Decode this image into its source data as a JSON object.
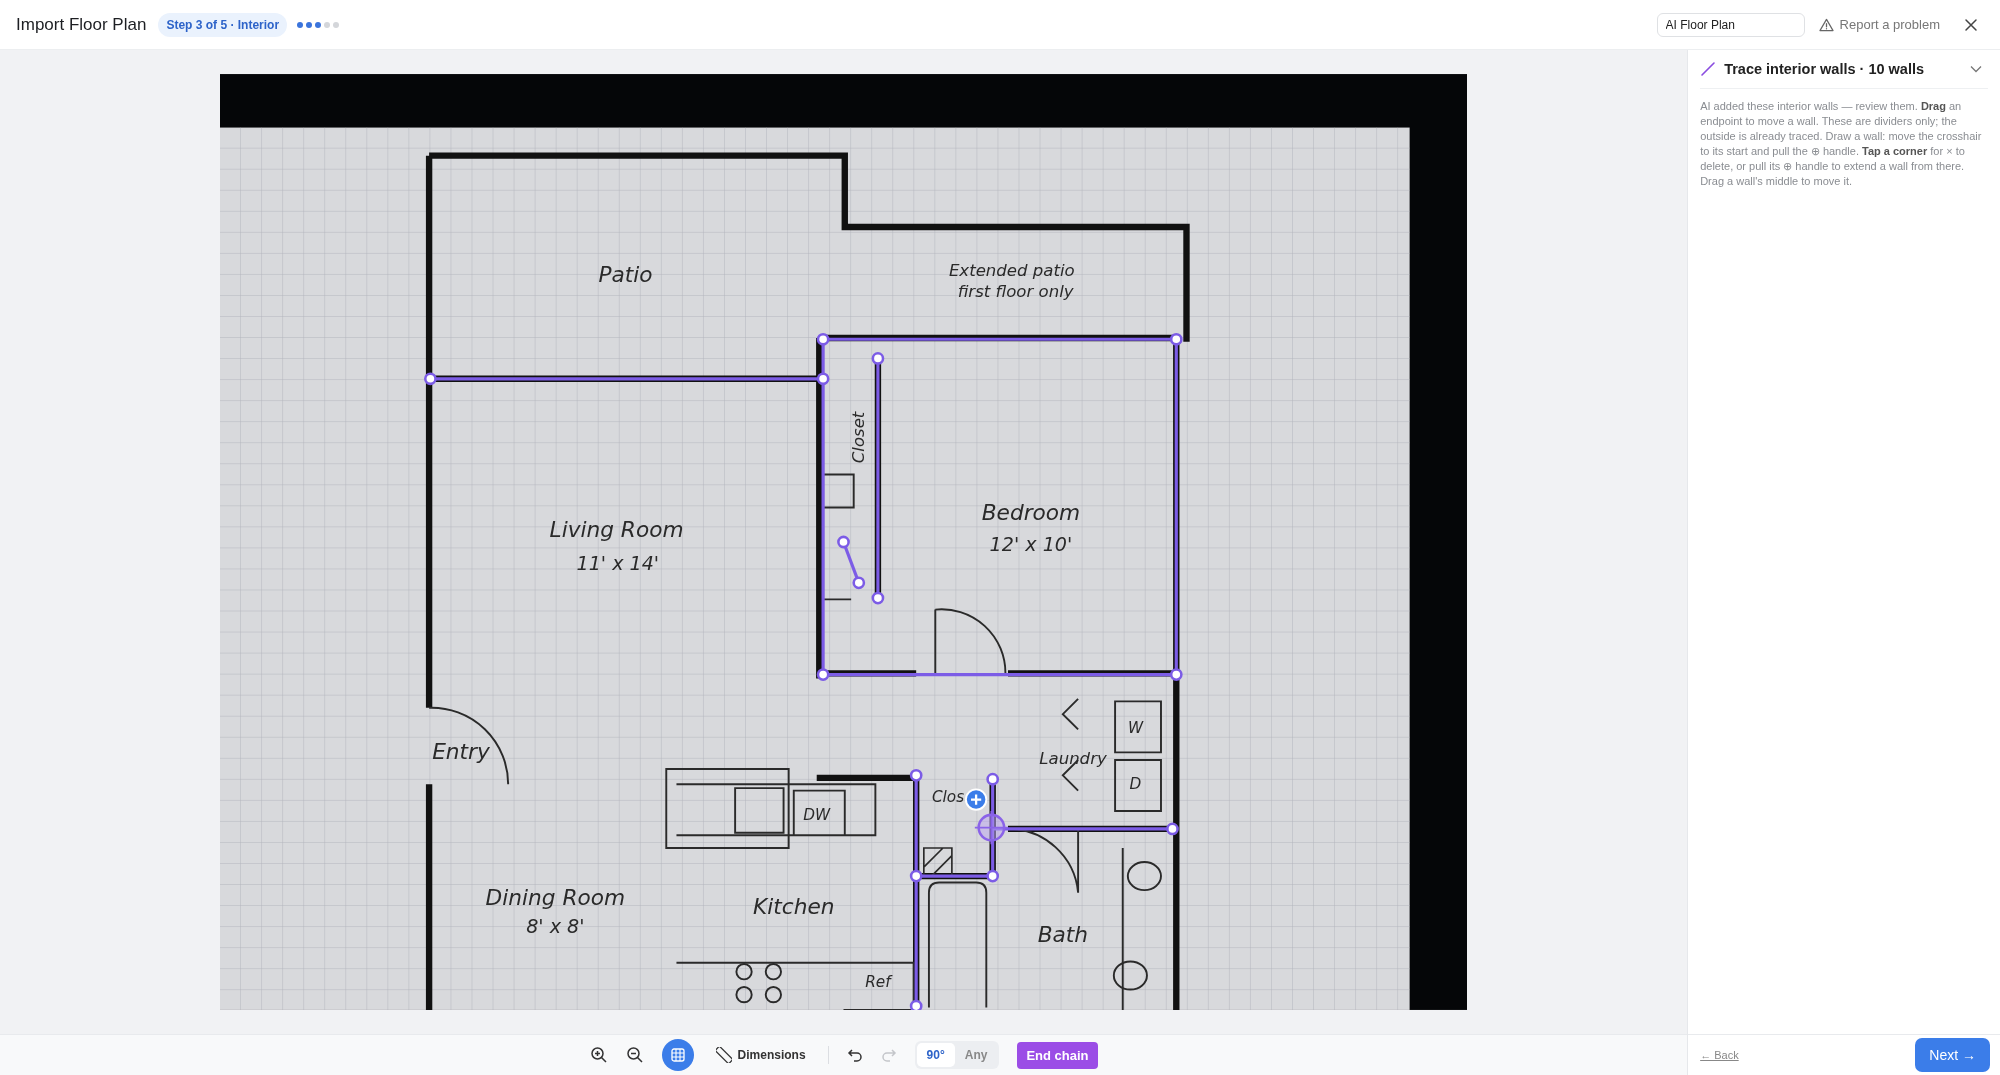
{
  "header": {
    "title": "Import Floor Plan",
    "step_badge": "Step 3 of 5 · Interior",
    "progress_dots": [
      {
        "filled": true
      },
      {
        "filled": true
      },
      {
        "filled": true
      },
      {
        "filled": false
      },
      {
        "filled": false
      }
    ],
    "plan_name": {
      "value": "AI Floor Plan"
    },
    "report_link": "Report a problem"
  },
  "plan": {
    "labels": [
      {
        "text": "Patio",
        "kind": "room"
      },
      {
        "text": "Extended patio",
        "kind": "note"
      },
      {
        "text": "first floor only",
        "kind": "note"
      },
      {
        "text": "Living Room",
        "kind": "room"
      },
      {
        "text": "11' x 14'",
        "kind": "size"
      },
      {
        "text": "Bedroom",
        "kind": "room"
      },
      {
        "text": "12' x 10'",
        "kind": "size"
      },
      {
        "text": "Closet",
        "kind": "note"
      },
      {
        "text": "Entry",
        "kind": "room"
      },
      {
        "text": "Laundry",
        "kind": "note"
      },
      {
        "text": "W",
        "kind": "fixture"
      },
      {
        "text": "D",
        "kind": "fixture"
      },
      {
        "text": "Clos",
        "kind": "fixture"
      },
      {
        "text": "DW",
        "kind": "fixture"
      },
      {
        "text": "Dining Room",
        "kind": "room"
      },
      {
        "text": "8' x 8'",
        "kind": "size"
      },
      {
        "text": "Kitchen",
        "kind": "room"
      },
      {
        "text": "Bath",
        "kind": "room"
      },
      {
        "text": "Ref",
        "kind": "fixture"
      }
    ]
  },
  "toolbar": {
    "grid_on": true,
    "dimensions": "Dimensions",
    "redo_disabled": true,
    "angle_modes": [
      {
        "label": "90°",
        "selected": true
      },
      {
        "label": "Any",
        "selected": false
      }
    ],
    "end_chain": "End chain"
  },
  "panel": {
    "title": "Trace interior walls · 10 walls",
    "expanded": true,
    "help": "AI added these interior walls — review them. **Drag** an endpoint to move a wall. These are dividers only; the outside is already traced. Draw a wall: move the crosshair to its start and pull the ⊕ handle. **Tap a corner** for × to delete, or pull its ⊕ handle to extend a wall from there. Drag a wall's middle to move it."
  },
  "footer": {
    "back": "← Back",
    "next": "Next →"
  }
}
